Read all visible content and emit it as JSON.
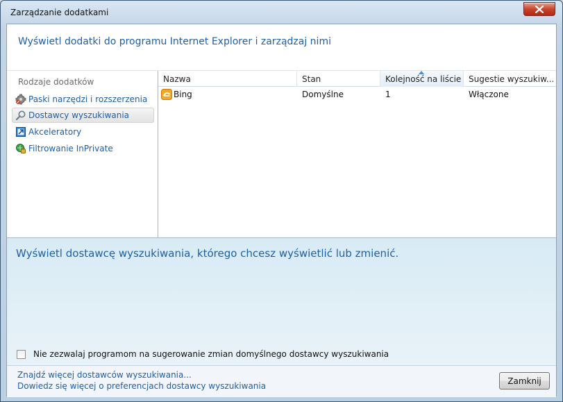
{
  "window": {
    "title": "Zarządzanie dodatkami"
  },
  "header": {
    "title": "Wyświetl dodatki do programu Internet Explorer i zarządzaj nimi"
  },
  "sidebar": {
    "heading": "Rodzaje dodatków",
    "items": [
      {
        "label": "Paski narzędzi i rozszerzenia",
        "icon": "gear-icon",
        "selected": false
      },
      {
        "label": "Dostawcy wyszukiwania",
        "icon": "search-icon",
        "selected": true
      },
      {
        "label": "Akceleratory",
        "icon": "accelerator-icon",
        "selected": false
      },
      {
        "label": "Filtrowanie InPrivate",
        "icon": "inprivate-icon",
        "selected": false
      }
    ]
  },
  "list": {
    "columns": [
      {
        "label": "Nazwa"
      },
      {
        "label": "Stan"
      },
      {
        "label": "Kolejność na liście",
        "sorted": true
      },
      {
        "label": "Sugestie wyszukiw..."
      }
    ],
    "rows": [
      {
        "name": "Bing",
        "icon": "bing-icon",
        "status": "Domyślne",
        "order": "1",
        "suggestions": "Włączone"
      }
    ]
  },
  "details": {
    "title": "Wyświetl dostawcę wyszukiwania, którego chcesz wyświetlić lub zmienić.",
    "checkbox_label": "Nie zezwalaj programom na sugerowanie zmian domyślnego dostawcy wyszukiwania",
    "checkbox_checked": false
  },
  "footer": {
    "link_find": "Znajdź więcej dostawców wyszukiwania...",
    "link_learn": "Dowiedz się więcej o preferencjach dostawcy wyszukiwania",
    "close_label": "Zamknij"
  },
  "colors": {
    "link": "#1e5fa8",
    "details_bg": "#ddeef6",
    "close_red": "#c7462d"
  }
}
